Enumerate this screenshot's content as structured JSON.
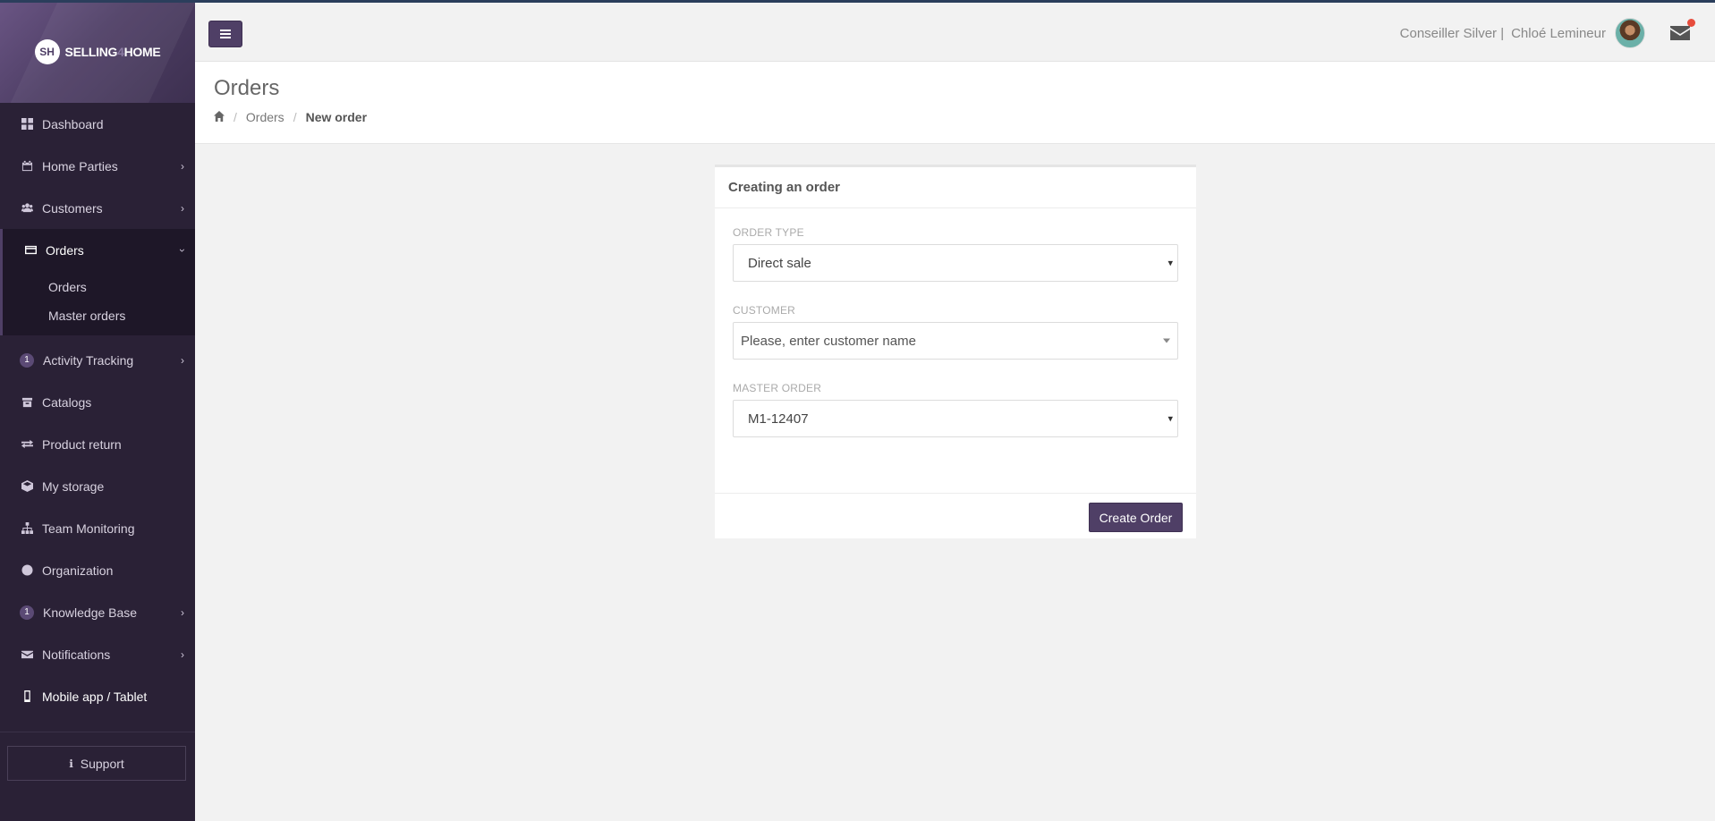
{
  "brand": {
    "logo_initials": "SH",
    "name_part1": "SELLING",
    "name_part2": "4",
    "name_part3": "HOME"
  },
  "sidebar": {
    "items": [
      {
        "label": "Dashboard",
        "icon": "dashboard-icon"
      },
      {
        "label": "Home Parties",
        "icon": "calendar-icon",
        "expandable": true
      },
      {
        "label": "Customers",
        "icon": "users-icon",
        "expandable": true
      },
      {
        "label": "Orders",
        "icon": "credit-card-icon",
        "expanded": true
      },
      {
        "label": "Activity Tracking",
        "badge": "1",
        "expandable": true
      },
      {
        "label": "Catalogs",
        "icon": "archive-icon"
      },
      {
        "label": "Product return",
        "icon": "exchange-icon"
      },
      {
        "label": "My storage",
        "icon": "cube-icon"
      },
      {
        "label": "Team Monitoring",
        "icon": "sitemap-icon"
      },
      {
        "label": "Organization",
        "icon": "globe-icon"
      },
      {
        "label": "Knowledge Base",
        "badge": "1",
        "expandable": true
      },
      {
        "label": "Notifications",
        "icon": "envelope-icon",
        "expandable": true
      },
      {
        "label": "Mobile app / Tablet",
        "icon": "mobile-icon"
      }
    ],
    "orders_sub": [
      "Orders",
      "Master orders"
    ],
    "support_label": "Support"
  },
  "header": {
    "rank": "Conseiller Silver |",
    "user_name": "Chloé Lemineur",
    "notification_dot_color": "#e74c3c"
  },
  "page": {
    "title": "Orders",
    "breadcrumb": {
      "sep": "/",
      "level1": "Orders",
      "current": "New order"
    }
  },
  "form": {
    "card_title": "Creating an order",
    "order_type_label": "ORDER TYPE",
    "order_type_value": "Direct sale",
    "customer_label": "CUSTOMER",
    "customer_placeholder": "Please, enter customer name",
    "master_order_label": "MASTER ORDER",
    "master_order_value": "M1-12407",
    "submit_label": "Create Order"
  },
  "colors": {
    "accent": "#4f3f66",
    "sidebar_bg": "#2a2136"
  }
}
